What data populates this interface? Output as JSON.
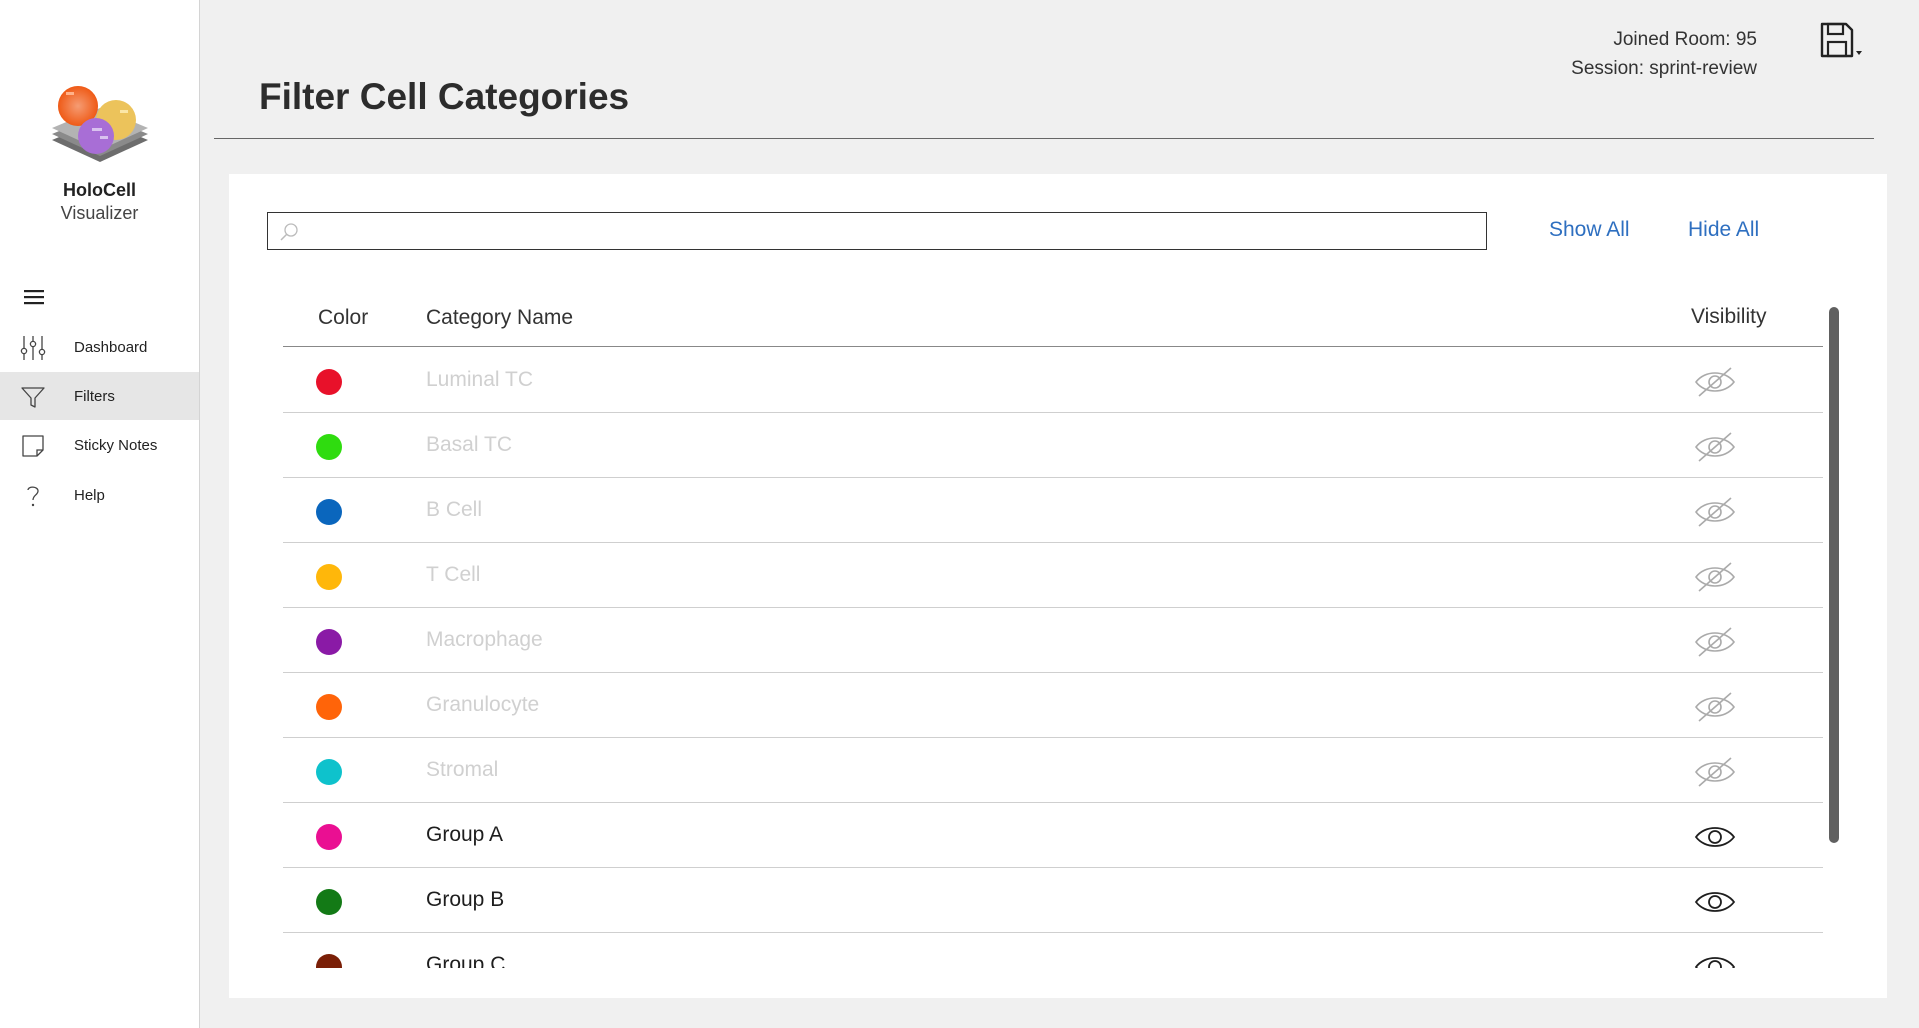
{
  "app": {
    "name": "HoloCell",
    "subtitle": "Visualizer"
  },
  "sidebar": {
    "items": [
      {
        "label": "Dashboard",
        "icon": "sliders-icon"
      },
      {
        "label": "Filters",
        "icon": "filter-icon",
        "active": true
      },
      {
        "label": "Sticky Notes",
        "icon": "sticky-note-icon"
      },
      {
        "label": "Help",
        "icon": "question-icon"
      }
    ]
  },
  "header": {
    "title": "Filter Cell Categories",
    "room": "Joined Room: 95",
    "session": "Session: sprint-review"
  },
  "search": {
    "value": "",
    "placeholder": ""
  },
  "actions": {
    "show_all": "Show All",
    "hide_all": "Hide All"
  },
  "table": {
    "columns": {
      "color": "Color",
      "name": "Category Name",
      "visibility": "Visibility"
    },
    "rows": [
      {
        "name": "Luminal TC",
        "color": "#e8112a",
        "visible": false
      },
      {
        "name": "Basal TC",
        "color": "#2fdc0f",
        "visible": false
      },
      {
        "name": "B Cell",
        "color": "#0a66bd",
        "visible": false
      },
      {
        "name": "T Cell",
        "color": "#ffb70a",
        "visible": false
      },
      {
        "name": "Macrophage",
        "color": "#8a1aa6",
        "visible": false
      },
      {
        "name": "Granulocyte",
        "color": "#ff6409",
        "visible": false
      },
      {
        "name": "Stromal",
        "color": "#0ec2cc",
        "visible": false
      },
      {
        "name": "Group A",
        "color": "#ea0f92",
        "visible": true
      },
      {
        "name": "Group B",
        "color": "#137a16",
        "visible": true
      },
      {
        "name": "Group C",
        "color": "#7a1f07",
        "visible": true
      }
    ]
  }
}
